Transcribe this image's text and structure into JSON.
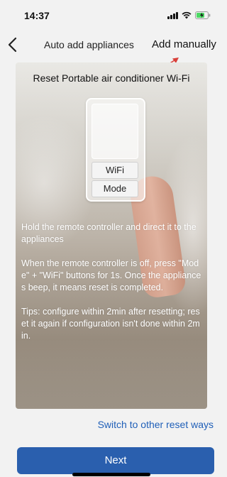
{
  "status_bar": {
    "time": "14:37",
    "icons": [
      "signal-icon",
      "wifi-icon",
      "battery-charging-icon"
    ]
  },
  "nav": {
    "back_icon": "chevron-left-icon",
    "title": "Auto add appliances",
    "add_manually": "Add manually",
    "annotation_icon": "red-arrow-icon",
    "annotation_color": "#d9403a"
  },
  "guide": {
    "title": "Reset Portable air conditioner Wi-Fi",
    "remote": {
      "wifi_button": "WiFi",
      "mode_button": "Mode"
    },
    "instructions": [
      "Hold the remote controller and direct it to the appliances",
      "When the remote controller is off, press \"Mode\" + \"WiFi\" buttons for 1s. Once the appliances beep, it means reset is completed.",
      "Tips: configure within 2min after resetting; reset it again if configuration isn't done within 2min."
    ]
  },
  "footer": {
    "switch_link": "Switch to other reset ways",
    "next_button": "Next"
  },
  "colors": {
    "accent": "#2a5fae",
    "link": "#1f5fb8",
    "background": "#f2f2f2"
  }
}
